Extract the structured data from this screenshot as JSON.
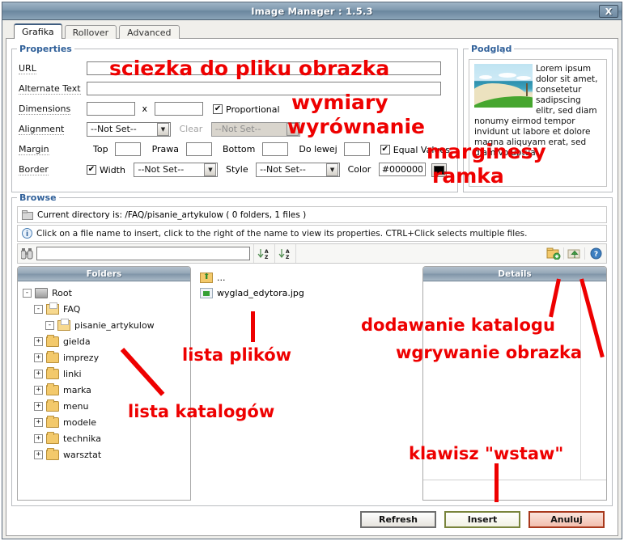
{
  "window": {
    "title": "Image Manager : 1.5.3",
    "close_label": "X"
  },
  "tabs": [
    {
      "label": "Grafika",
      "active": true
    },
    {
      "label": "Rollover",
      "active": false
    },
    {
      "label": "Advanced",
      "active": false
    }
  ],
  "properties": {
    "legend": "Properties",
    "url_label": "URL",
    "url_value": "",
    "alt_label": "Alternate Text",
    "alt_value": "",
    "dimensions_label": "Dimensions",
    "dim_w": "",
    "dim_h": "",
    "dim_sep": "x",
    "proportional_label": "Proportional",
    "proportional_checked": "✔",
    "alignment_label": "Alignment",
    "alignment_value": "--Not Set--",
    "clear_label": "Clear",
    "clear_value": "--Not Set--",
    "margin_label": "Margin",
    "margin_top_label": "Top",
    "margin_top_value": "",
    "margin_right_label": "Prawa",
    "margin_right_value": "",
    "margin_bottom_label": "Bottom",
    "margin_bottom_value": "",
    "margin_left_label": "Do lewej",
    "margin_left_value": "",
    "equal_values_label": "Equal Values",
    "equal_values_checked": "✔",
    "border_label": "Border",
    "width_label": "Width",
    "width_checked": "✔",
    "width_value": "--Not Set--",
    "style_label": "Style",
    "style_value": "--Not Set--",
    "color_label": "Color",
    "color_value": "#000000",
    "color_swatch": "#000000"
  },
  "preview": {
    "legend": "Podgląd",
    "text": "Lorem ipsum dolor sit amet, consetetur sadipscing elitr, sed diam nonumy eirmod tempor invidunt ut labore et dolore magna aliquyam erat, sed diam voluptua."
  },
  "browse": {
    "legend": "Browse",
    "current_directory": "Current directory is: /FAQ/pisanie_artykulow ( 0 folders, 1 files )",
    "hint": "Click on a file name to insert, click to the right of the name to view its properties. CTRL+Click selects multiple files.",
    "search_value": "",
    "search_placeholder": "",
    "icons": {
      "search": "binoculars-icon",
      "sort_asc": "sort-az-icon",
      "sort_desc": "sort-za-icon",
      "add_folder": "add-folder-icon",
      "upload": "upload-image-icon",
      "help": "help-icon"
    }
  },
  "folders_panel": {
    "header": "Folders",
    "items": [
      {
        "label": "Root",
        "depth": 0,
        "expander": "-",
        "icon": "drive-icon"
      },
      {
        "label": "FAQ",
        "depth": 1,
        "expander": "-",
        "icon": "folder-open-icon"
      },
      {
        "label": "pisanie_artykulow",
        "depth": 2,
        "expander": "-",
        "icon": "folder-open-icon"
      },
      {
        "label": "gielda",
        "depth": 1,
        "expander": "+",
        "icon": "folder-icon"
      },
      {
        "label": "imprezy",
        "depth": 1,
        "expander": "+",
        "icon": "folder-icon"
      },
      {
        "label": "linki",
        "depth": 1,
        "expander": "+",
        "icon": "folder-icon"
      },
      {
        "label": "marka",
        "depth": 1,
        "expander": "+",
        "icon": "folder-icon"
      },
      {
        "label": "menu",
        "depth": 1,
        "expander": "+",
        "icon": "folder-icon"
      },
      {
        "label": "modele",
        "depth": 1,
        "expander": "+",
        "icon": "folder-icon"
      },
      {
        "label": "technika",
        "depth": 1,
        "expander": "+",
        "icon": "folder-icon"
      },
      {
        "label": "warsztat",
        "depth": 1,
        "expander": "+",
        "icon": "folder-icon"
      }
    ]
  },
  "files_panel": {
    "items": [
      {
        "label": "...",
        "icon": "folder-up-icon"
      },
      {
        "label": "wyglad_edytora.jpg",
        "icon": "image-file-icon"
      }
    ]
  },
  "details_panel": {
    "header": "Details"
  },
  "footer": {
    "refresh_label": "Refresh",
    "insert_label": "Insert",
    "cancel_label": "Anuluj"
  },
  "annotations": {
    "color": "#ee0000",
    "items": [
      {
        "text": "sciezka do pliku obrazka"
      },
      {
        "text": "wymiary"
      },
      {
        "text": "wyrównanie"
      },
      {
        "text": "marginesy"
      },
      {
        "text": "ramka"
      },
      {
        "text": "dodawanie katalogu"
      },
      {
        "text": "wgrywanie obrazka"
      },
      {
        "text": "lista plików"
      },
      {
        "text": "lista katalogów"
      },
      {
        "text": "klawisz \"wstaw\""
      }
    ]
  }
}
